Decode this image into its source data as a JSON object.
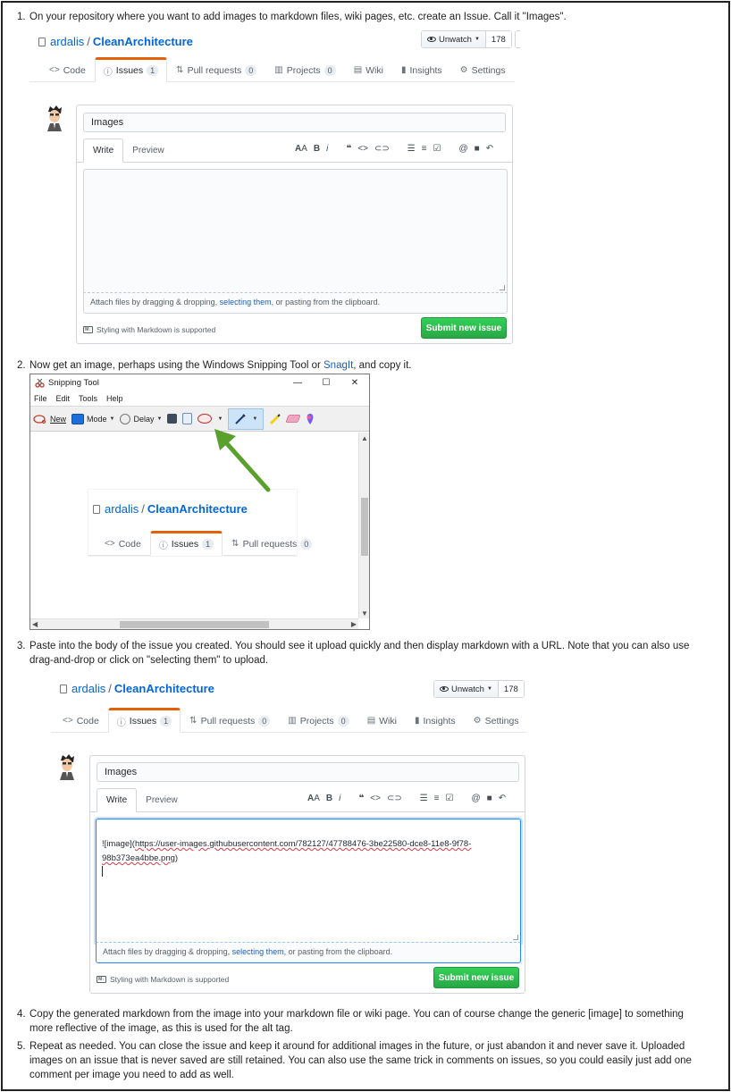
{
  "steps": {
    "s1": "On your repository where you want to add images to markdown files, wiki pages, etc. create an Issue. Call it \"Images\".",
    "s2_pre": "Now get an image, perhaps using the Windows Snipping Tool or ",
    "s2_link": "SnagIt",
    "s2_post": ", and copy it.",
    "s3_line1": "Paste into the body of the issue you created. You should see it upload quickly and then display markdown with a URL. Note that you can also use",
    "s3_line2": "drag-and-drop or click on \"selecting them\" to upload.",
    "s4_line1": "Copy the generated markdown from the image into your markdown file or wiki page. You can of course change the generic [image] to something",
    "s4_line2": "more reflective of the image, as this is used for the alt tag.",
    "s5_line1": "Repeat as needed. You can close the issue and keep it around for additional images in the future, or just abandon it and never save it. Uploaded",
    "s5_line2": "images on an issue that is never saved are still retained. You can also use the same trick in comments on issues, so you could easily just add one",
    "s5_line3": "comment per image you need to add as well."
  },
  "numbers": [
    "1.",
    "2.",
    "3.",
    "4.",
    "5."
  ],
  "repo": {
    "owner": "ardalis",
    "separator": "/",
    "name": "CleanArchitecture",
    "watch_label": "Unwatch",
    "watch_count": "178",
    "tabs": {
      "code": "Code",
      "issues": "Issues",
      "issues_count": "1",
      "pulls": "Pull requests",
      "pulls_count": "0",
      "projects": "Projects",
      "projects_count": "0",
      "wiki": "Wiki",
      "insights": "Insights",
      "settings": "Settings"
    }
  },
  "issue": {
    "title_value": "Images",
    "write_tab": "Write",
    "preview_tab": "Preview",
    "attach_pre": "Attach files by dragging & dropping, ",
    "attach_link": "selecting them",
    "attach_post": ", or pasting from the clipboard.",
    "md_note": "Styling with Markdown is supported",
    "submit": "Submit new issue",
    "body_prefix": "![image](",
    "body_url_line1": "https://user-images.githubusercontent.com/782127/47788476-3be22580-dce8-11e8-9f78-",
    "body_url_line2": "98b373ea4bbe.png",
    "body_suffix": ")"
  },
  "snipping": {
    "title": "Snipping Tool",
    "menu": [
      "File",
      "Edit",
      "Tools",
      "Help"
    ],
    "new": "New",
    "mode": "Mode",
    "delay": "Delay"
  },
  "colors": {
    "accent_tab": "#e36209",
    "link": "#0366d6",
    "submit": "#28a745",
    "arrow": "#5aa02c"
  }
}
